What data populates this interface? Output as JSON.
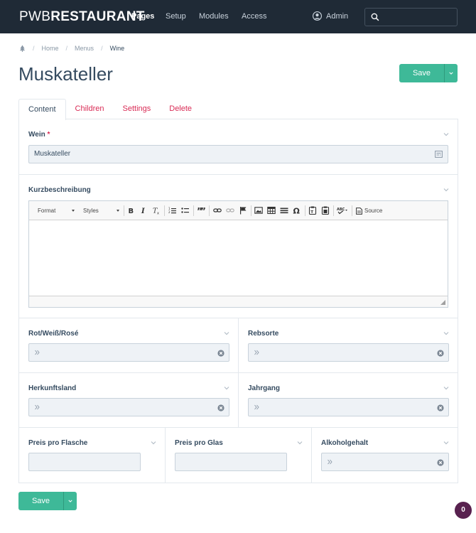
{
  "topbar": {
    "logo_light": "PWB",
    "logo_bold": "RESTAURANT",
    "nav": [
      "Pages",
      "Setup",
      "Modules",
      "Access"
    ],
    "user": "Admin",
    "search_placeholder": ""
  },
  "breadcrumb": [
    "Home",
    "Menus",
    "Wine"
  ],
  "page_title": "Muskateller",
  "save_label": "Save",
  "tabs": [
    "Content",
    "Children",
    "Settings",
    "Delete"
  ],
  "fields": {
    "wein": {
      "label": "Wein",
      "required_mark": "*",
      "value": "Muskateller"
    },
    "kurzbeschreibung": {
      "label": "Kurzbeschreibung"
    },
    "rot_weiss_rose": {
      "label": "Rot/Weiß/Rosé"
    },
    "rebsorte": {
      "label": "Rebsorte"
    },
    "herkunftsland": {
      "label": "Herkunftsland"
    },
    "jahrgang": {
      "label": "Jahrgang"
    },
    "preis_flasche": {
      "label": "Preis pro Flasche"
    },
    "preis_glas": {
      "label": "Preis pro Glas"
    },
    "alkoholgehalt": {
      "label": "Alkoholgehalt"
    }
  },
  "editor": {
    "format_label": "Format",
    "styles_label": "Styles",
    "source_label": "Source",
    "buttons": [
      "bold-icon",
      "italic-icon",
      "remove-format-icon",
      "numbered-list-icon",
      "bullet-list-icon",
      "blockquote-icon",
      "link-icon",
      "unlink-icon",
      "anchor-icon",
      "image-icon",
      "table-icon",
      "horizontal-rule-icon",
      "special-char-icon",
      "paste-text-icon",
      "paste-word-icon",
      "spellcheck-icon",
      "source-icon"
    ]
  },
  "notification_count": "0",
  "colors": {
    "topbar": "#1f2a36",
    "accent": "#3eb998",
    "link": "#d92b55",
    "badge": "#58214f"
  }
}
